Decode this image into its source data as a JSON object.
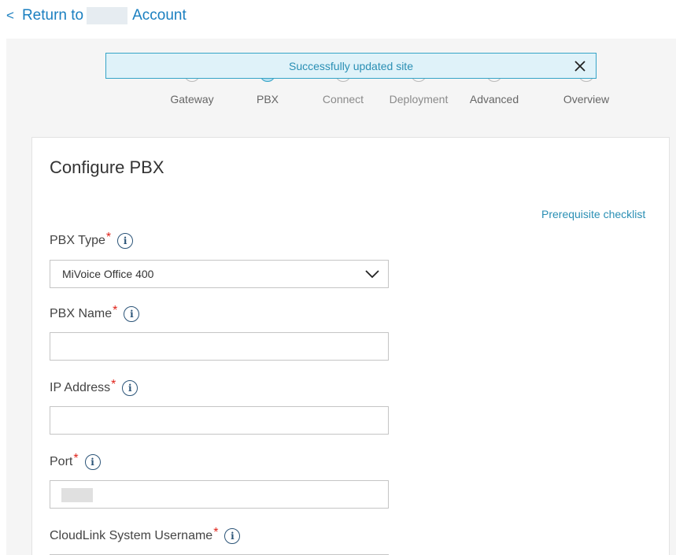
{
  "nav": {
    "back_prefix": "Return to",
    "back_suffix": "Account",
    "chevron": "<"
  },
  "toast": {
    "message": "Successfully updated site"
  },
  "steps": [
    {
      "label": "Gateway"
    },
    {
      "label": "PBX"
    },
    {
      "label": "Connect"
    },
    {
      "label": "Deployment"
    },
    {
      "label": "Advanced"
    },
    {
      "label": "Overview"
    }
  ],
  "form": {
    "title": "Configure PBX",
    "prereq_link": "Prerequisite checklist",
    "required_mark": "*",
    "info_glyph": "i",
    "pbx_type": {
      "label": "PBX Type",
      "value": "MiVoice Office 400"
    },
    "pbx_name": {
      "label": "PBX Name",
      "value": ""
    },
    "ip_address": {
      "label": "IP Address",
      "value": ""
    },
    "port": {
      "label": "Port"
    },
    "cloudlink_username": {
      "label": "CloudLink System Username"
    }
  },
  "colors": {
    "accent": "#2a8fb4",
    "link": "#1a7fc0",
    "required": "#e0241b",
    "toast_bg": "#dff2f9"
  }
}
